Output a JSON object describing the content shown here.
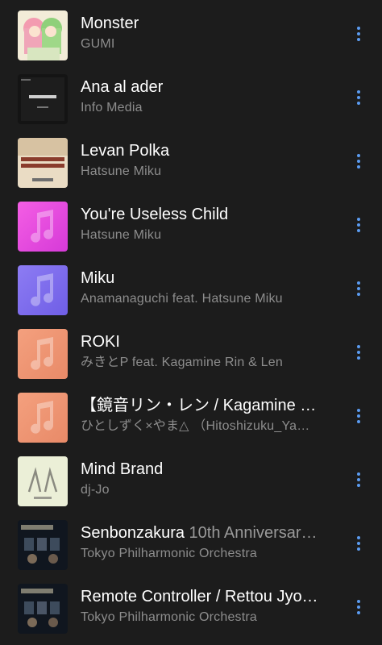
{
  "colors": {
    "background": "#1c1c1c",
    "title": "#ffffff",
    "subtitle": "#8d8d8d",
    "more_icon": "#5b9cf1"
  },
  "tracks": [
    {
      "title": "Monster",
      "title_suffix": "",
      "artist": "GUMI",
      "art": "anime-pink-green"
    },
    {
      "title": "Ana al ader",
      "title_suffix": "",
      "artist": "Info Media",
      "art": "dark-cover"
    },
    {
      "title": "Levan Polka",
      "title_suffix": "",
      "artist": "Hatsune Miku",
      "art": "beige-cover"
    },
    {
      "title": "You're Useless Child",
      "title_suffix": "",
      "artist": "Hatsune Miku",
      "art": "magenta-note"
    },
    {
      "title": "Miku",
      "title_suffix": "",
      "artist": "Anamanaguchi feat. Hatsune Miku",
      "art": "violet-note"
    },
    {
      "title": "ROKI",
      "title_suffix": "",
      "artist": "みきとP feat. Kagamine Rin & Len",
      "art": "peach-note"
    },
    {
      "title": "【鏡音リン・レン / Kagamine …",
      "title_suffix": "",
      "artist": "ひとしずく×やま△ （Hitoshizuku_Ya…",
      "art": "peach-note"
    },
    {
      "title": "Mind Brand",
      "title_suffix": "",
      "artist": "dj-Jo",
      "art": "light-logo"
    },
    {
      "title": "Senbonzakura",
      "title_suffix": " 10th Anniversar…",
      "artist": "Tokyo Philharmonic Orchestra",
      "art": "orchestra-cover"
    },
    {
      "title": "Remote Controller / Rettou Jyo…",
      "title_suffix": "",
      "artist": "Tokyo Philharmonic Orchestra",
      "art": "orchestra-cover"
    }
  ]
}
